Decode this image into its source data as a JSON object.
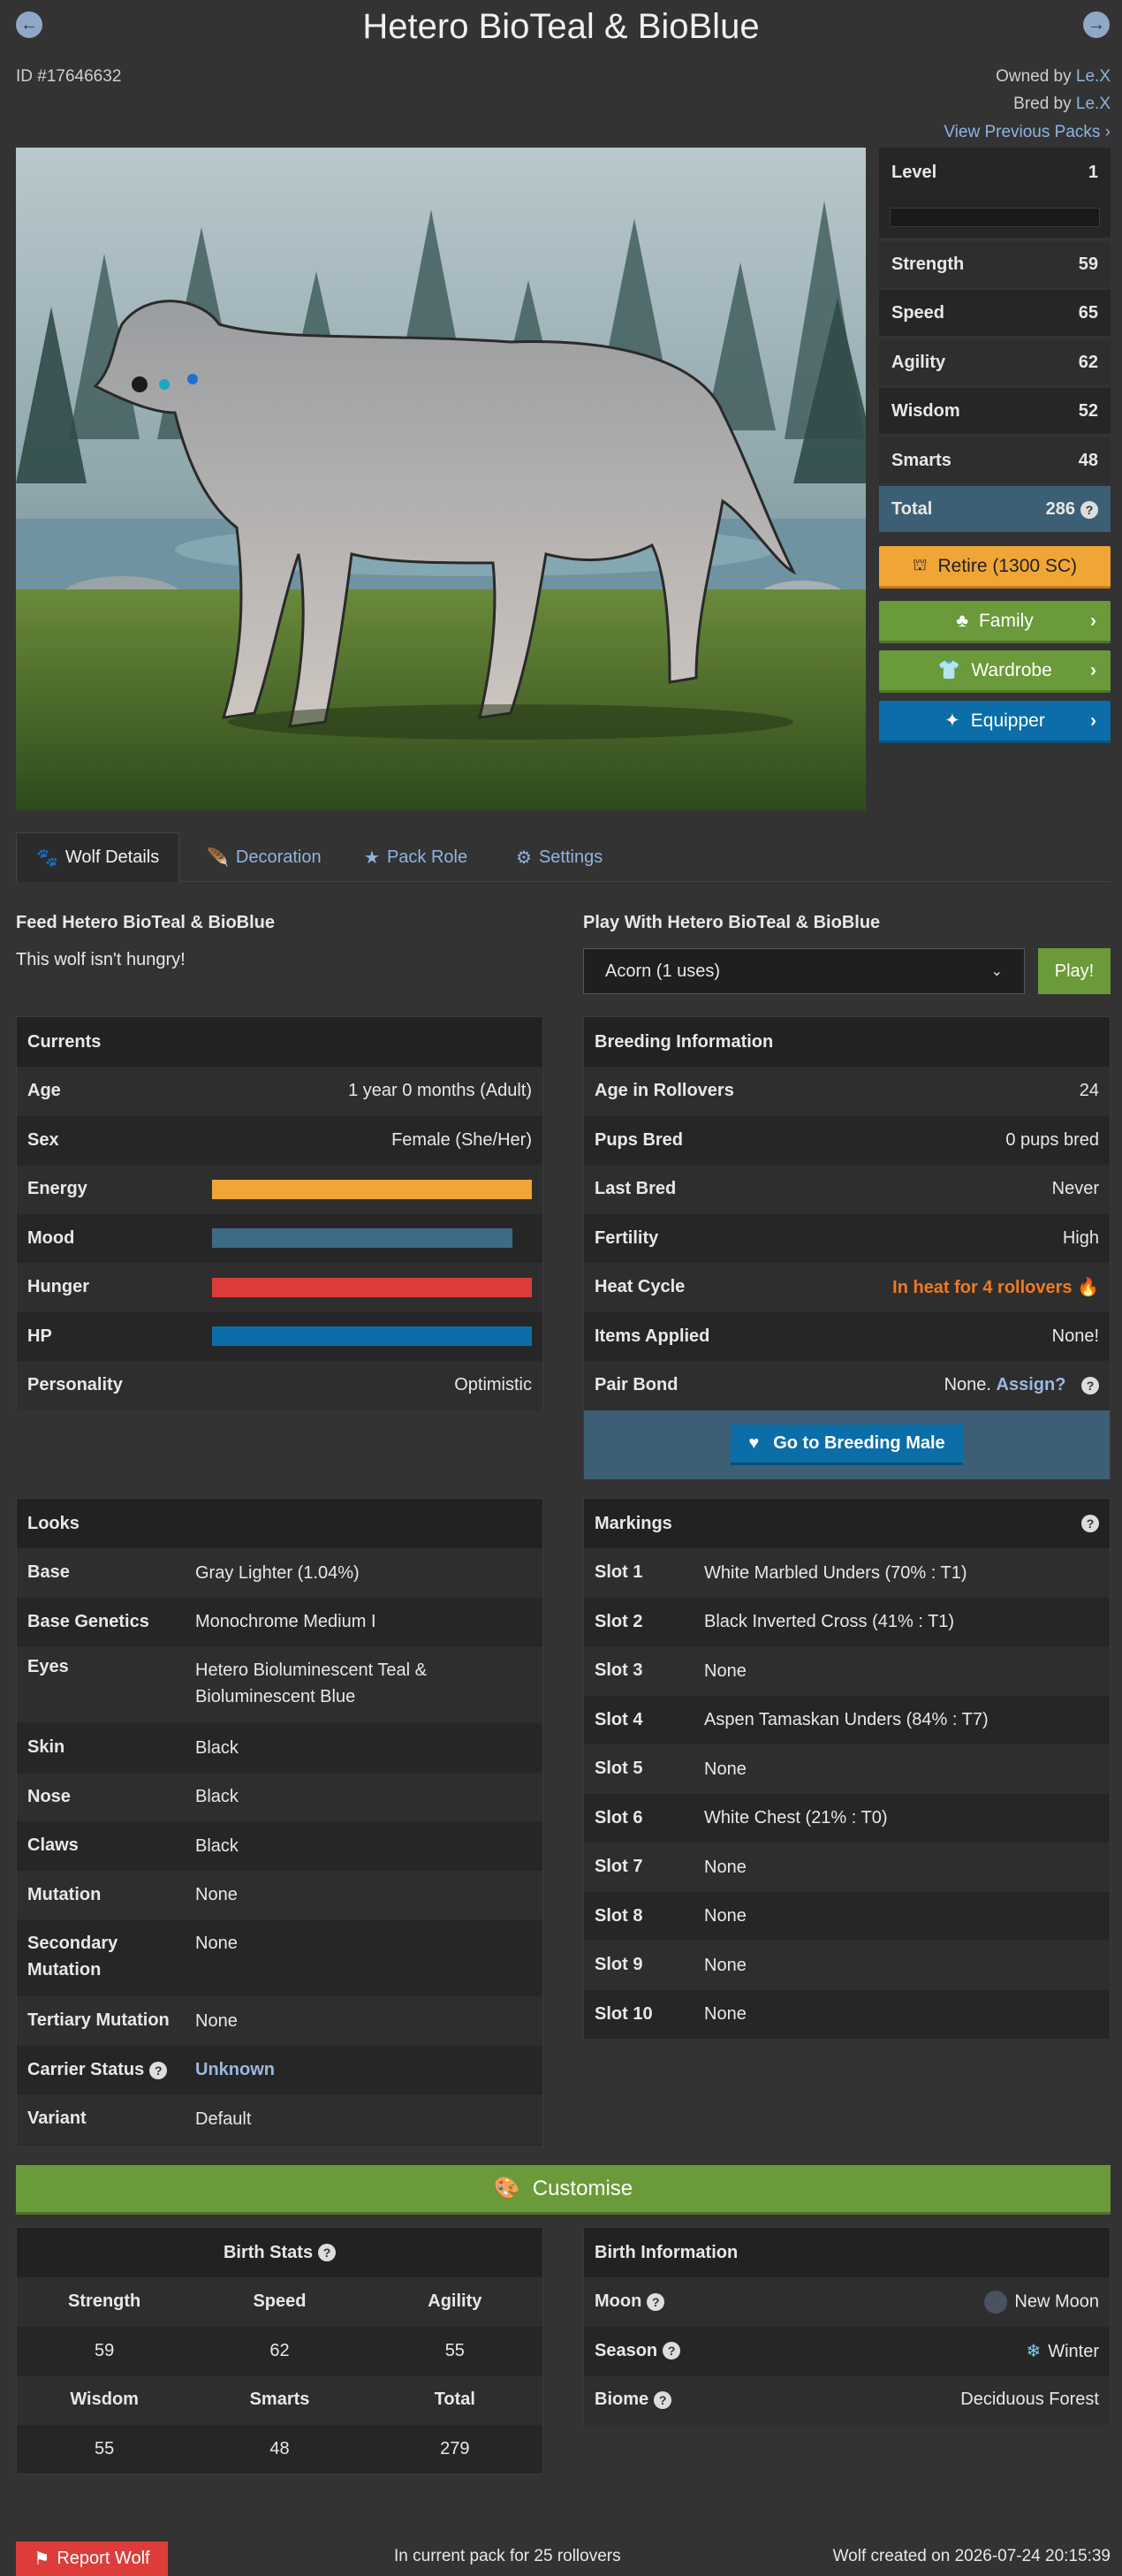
{
  "header": {
    "title": "Hetero BioTeal & BioBlue",
    "id_text": "ID #17646632",
    "owned_by_label": "Owned by",
    "owner": "Le.X",
    "bred_by_label": "Bred by",
    "breeder": "Le.X",
    "view_previous": "View Previous Packs",
    "prev_arrow": "←",
    "next_arrow": "→"
  },
  "stats": {
    "level_label": "Level",
    "level": "1",
    "strength_label": "Strength",
    "strength": "59",
    "speed_label": "Speed",
    "speed": "65",
    "agility_label": "Agility",
    "agility": "62",
    "wisdom_label": "Wisdom",
    "wisdom": "52",
    "smarts_label": "Smarts",
    "smarts": "48",
    "total_label": "Total",
    "total": "286"
  },
  "actions": {
    "retire": "Retire (1300 SC)",
    "family": "Family",
    "wardrobe": "Wardrobe",
    "equipper": "Equipper"
  },
  "tabs": [
    "Wolf Details",
    "Decoration",
    "Pack Role",
    "Settings"
  ],
  "feed": {
    "title": "Feed Hetero BioTeal & BioBlue",
    "text": "This wolf isn't hungry!"
  },
  "play": {
    "title": "Play With Hetero BioTeal & BioBlue",
    "selected": "Acorn (1 uses)",
    "button": "Play!"
  },
  "currents": {
    "title": "Currents",
    "age_label": "Age",
    "age": "1 year 0 months (Adult)",
    "sex_label": "Sex",
    "sex": "Female (She/Her)",
    "energy_label": "Energy",
    "energy": 1.0,
    "mood_label": "Mood",
    "mood": 0.94,
    "hunger_label": "Hunger",
    "hunger": 1.0,
    "hp_label": "HP",
    "hp": 1.0,
    "personality_label": "Personality",
    "personality": "Optimistic",
    "colors": {
      "energy": "#f0a637",
      "mood": "#3d6a84",
      "hunger": "#dc3d3a",
      "hp": "#0b6ea8"
    }
  },
  "breeding": {
    "title": "Breeding Information",
    "rollovers_label": "Age in Rollovers",
    "rollovers": "24",
    "pups_label": "Pups Bred",
    "pups": "0 pups bred",
    "last_label": "Last Bred",
    "last": "Never",
    "fertility_label": "Fertility",
    "fertility": "High",
    "heat_label": "Heat Cycle",
    "heat": "In heat for 4 rollovers",
    "items_label": "Items Applied",
    "items": "None!",
    "pair_label": "Pair Bond",
    "pair": "None.",
    "pair_assign": "Assign?",
    "go_button": "Go to Breeding Male"
  },
  "looks": {
    "title": "Looks",
    "rows": [
      {
        "label": "Base",
        "value": "Gray Lighter (1.04%)"
      },
      {
        "label": "Base Genetics",
        "value": "Monochrome Medium I"
      },
      {
        "label": "Eyes",
        "value": "Hetero Bioluminescent Teal & Bioluminescent Blue"
      },
      {
        "label": "Skin",
        "value": "Black"
      },
      {
        "label": "Nose",
        "value": "Black"
      },
      {
        "label": "Claws",
        "value": "Black"
      },
      {
        "label": "Mutation",
        "value": "None"
      },
      {
        "label": "Secondary Mutation",
        "value": "None"
      },
      {
        "label": "Tertiary Mutation",
        "value": "None"
      },
      {
        "label": "Carrier Status",
        "value": "Unknown"
      },
      {
        "label": "Variant",
        "value": "Default"
      }
    ]
  },
  "markings": {
    "title": "Markings",
    "rows": [
      {
        "label": "Slot 1",
        "value": "White Marbled Unders (70% : T1)"
      },
      {
        "label": "Slot 2",
        "value": "Black Inverted Cross (41% : T1)"
      },
      {
        "label": "Slot 3",
        "value": "None"
      },
      {
        "label": "Slot 4",
        "value": "Aspen Tamaskan Unders (84% : T7)"
      },
      {
        "label": "Slot 5",
        "value": "None"
      },
      {
        "label": "Slot 6",
        "value": "White Chest (21% : T0)"
      },
      {
        "label": "Slot 7",
        "value": "None"
      },
      {
        "label": "Slot 8",
        "value": "None"
      },
      {
        "label": "Slot 9",
        "value": "None"
      },
      {
        "label": "Slot 10",
        "value": "None"
      }
    ]
  },
  "customise": "Customise",
  "birth_stats": {
    "title": "Birth Stats",
    "headers1": [
      "Strength",
      "Speed",
      "Agility"
    ],
    "values1": [
      "59",
      "62",
      "55"
    ],
    "headers2": [
      "Wisdom",
      "Smarts",
      "Total"
    ],
    "values2": [
      "55",
      "48",
      "279"
    ]
  },
  "birth_info": {
    "title": "Birth Information",
    "moon_label": "Moon",
    "moon": "New Moon",
    "season_label": "Season",
    "season": "Winter",
    "biome_label": "Biome",
    "biome": "Deciduous Forest"
  },
  "footer": {
    "report": "Report Wolf",
    "pack_text": "In current pack for 25 rollovers",
    "created": "Wolf created on 2026-07-24 20:15:39"
  }
}
